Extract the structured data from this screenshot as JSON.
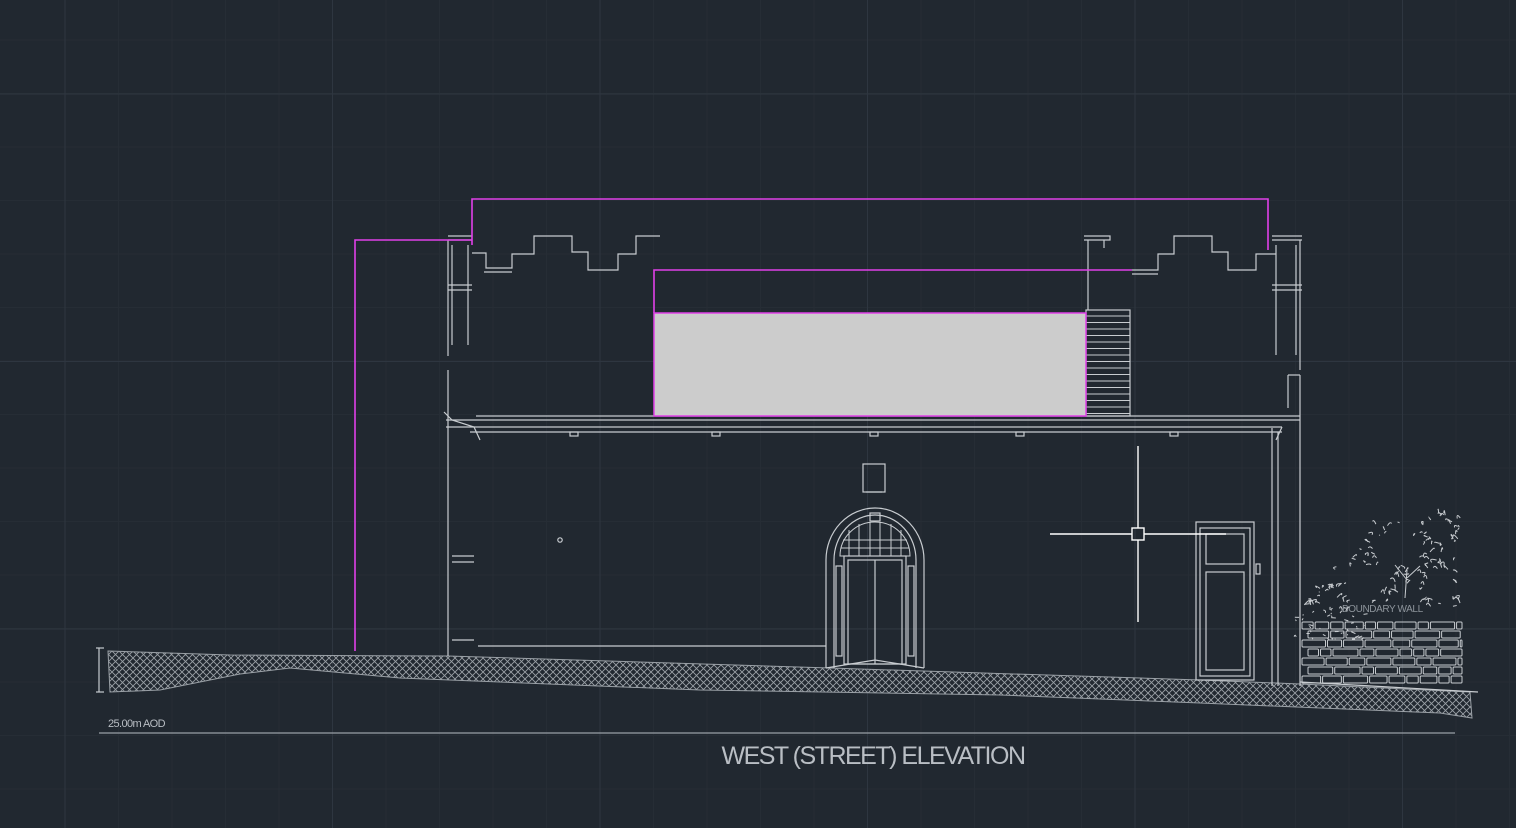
{
  "drawing": {
    "title": "WEST (STREET) ELEVATION",
    "level_label": "25.00m AOD",
    "wall_label": "BOUNDARY WALL"
  },
  "colors": {
    "background": "#212830",
    "grid_minor": "#262d35",
    "grid_major": "#2e3640",
    "linework": "#c8ccd0",
    "highlight": "#e040e8",
    "infill": "#cccccc",
    "crosshair": "#ffffff"
  },
  "cursor": {
    "type": "crosshair-pickbox"
  }
}
